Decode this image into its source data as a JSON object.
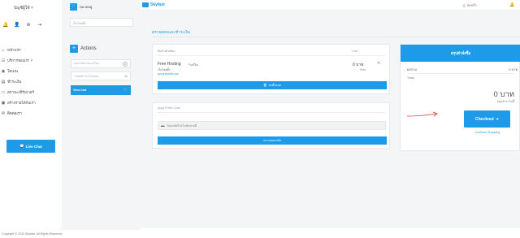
{
  "account": {
    "name": "บัญชีผู้ใช้ ˅"
  },
  "nav": {
    "items": [
      {
        "icon": "home-icon",
        "label": "หน้าแรก"
      },
      {
        "icon": "services-icon",
        "label": "บริการของเรา ˅"
      },
      {
        "icon": "domains-icon",
        "label": "โดเมน"
      },
      {
        "icon": "billing-icon",
        "label": "ชำระเงิน"
      },
      {
        "icon": "support-icon",
        "label": "สถานะเซิร์ฟเวอร์"
      },
      {
        "icon": "affiliate-icon",
        "label": "สร้างรายได้กับเรา"
      },
      {
        "icon": "contact-icon",
        "label": "ติดต่อเรา"
      }
    ],
    "live_chat": "Live Chat"
  },
  "categories": {
    "title": "หมวดหมู่",
    "field": "เว็บโฮสติ้ง"
  },
  "actions": {
    "title": "Actions",
    "items": [
      {
        "label": "จดทะเบียนโดเมนใหม่",
        "icon": "globe-icon"
      },
      {
        "label": "Transfer in a Domain",
        "icon": "share-icon"
      }
    ],
    "view_cart": "View Cart"
  },
  "topbar": {
    "brand": "Skyfast",
    "cart_text": "ตะกร้า"
  },
  "main": {
    "heading": "ตรวจสอบและชำระเงิน",
    "cart": {
      "col_product": "สินค้า/ตัวเลือก",
      "col_price": "ราคา",
      "product_name": "Free Hosting",
      "edit_label": "แก้ไข",
      "product_group": "เว็บโฮสติ้ง",
      "product_domain": "gonq.skyfast.xyz",
      "price": "0 บาท",
      "cycle": "Free",
      "empty_cart": "ลบทั้งหมด"
    },
    "promo": {
      "label": "Apply Promo Code",
      "placeholder": "ป้อนรหัสโปรโมชันหากมี",
      "validate": "ตรวจสอบรหัส"
    },
    "summary": {
      "title": "สรุปคำสั่งซื้อ",
      "subtotal_label": "ผลรวม",
      "subtotal_value": "0 บาท",
      "totals_label": "Totals",
      "total": "0 บาท",
      "due_label": "ยอดชำระวันนี้",
      "checkout": "Checkout",
      "continue": "Continue Shopping"
    }
  },
  "footer": "Copyright © 2020 Skyfast. All Rights Reserved.",
  "colors": {
    "accent": "#1e9be8",
    "annotation": "#e53935"
  }
}
